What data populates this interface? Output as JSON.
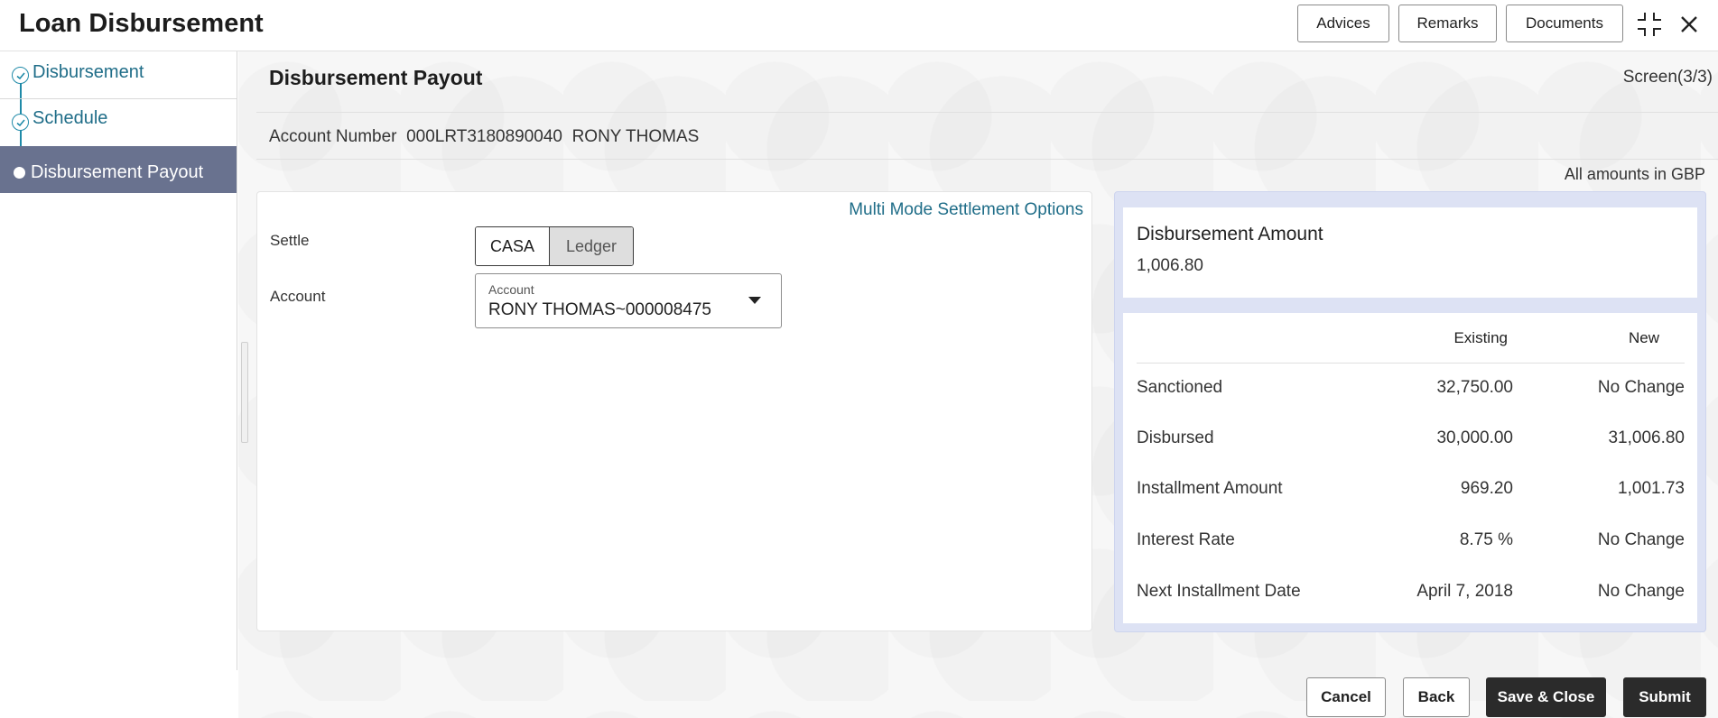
{
  "header": {
    "title": "Loan Disbursement",
    "buttons": {
      "advices": "Advices",
      "remarks": "Remarks",
      "documents": "Documents"
    },
    "icons": {
      "collapse": "collapse-icon",
      "close": "close-icon"
    }
  },
  "sidebar": {
    "steps": [
      {
        "label": "Disbursement",
        "state": "completed"
      },
      {
        "label": "Schedule",
        "state": "completed"
      },
      {
        "label": "Disbursement Payout",
        "state": "active"
      }
    ]
  },
  "main": {
    "title": "Disbursement Payout",
    "screen": "Screen(3/3)",
    "account_label": "Account Number",
    "account_number": "000LRT3180890040",
    "account_name": "RONY THOMAS",
    "amounts_note": "All amounts in GBP"
  },
  "settlement": {
    "multi_mode_link": "Multi Mode Settlement Options",
    "settle_label": "Settle",
    "settle_options": [
      "CASA",
      "Ledger"
    ],
    "settle_selected": "CASA",
    "account_label": "Account",
    "account_field_label": "Account",
    "account_value": "RONY THOMAS~000008475"
  },
  "summary": {
    "amount_title": "Disbursement Amount",
    "amount_value": "1,006.80",
    "columns": {
      "existing": "Existing",
      "new": "New"
    },
    "rows": [
      {
        "label": "Sanctioned",
        "existing": "32,750.00",
        "new": "No Change"
      },
      {
        "label": "Disbursed",
        "existing": "30,000.00",
        "new": "31,006.80"
      },
      {
        "label": "Installment Amount",
        "existing": "969.20",
        "new": "1,001.73"
      },
      {
        "label": "Interest Rate",
        "existing": "8.75 %",
        "new": "No Change"
      },
      {
        "label": "Next Installment Date",
        "existing": "April 7, 2018",
        "new": "No Change"
      }
    ]
  },
  "footer": {
    "cancel": "Cancel",
    "back": "Back",
    "save_close": "Save & Close",
    "submit": "Submit"
  },
  "colors": {
    "accent": "#1f6d88",
    "active_step_bg": "#69728f",
    "summary_bg": "#dde2f4",
    "primary_button": "#2b2b2b"
  }
}
